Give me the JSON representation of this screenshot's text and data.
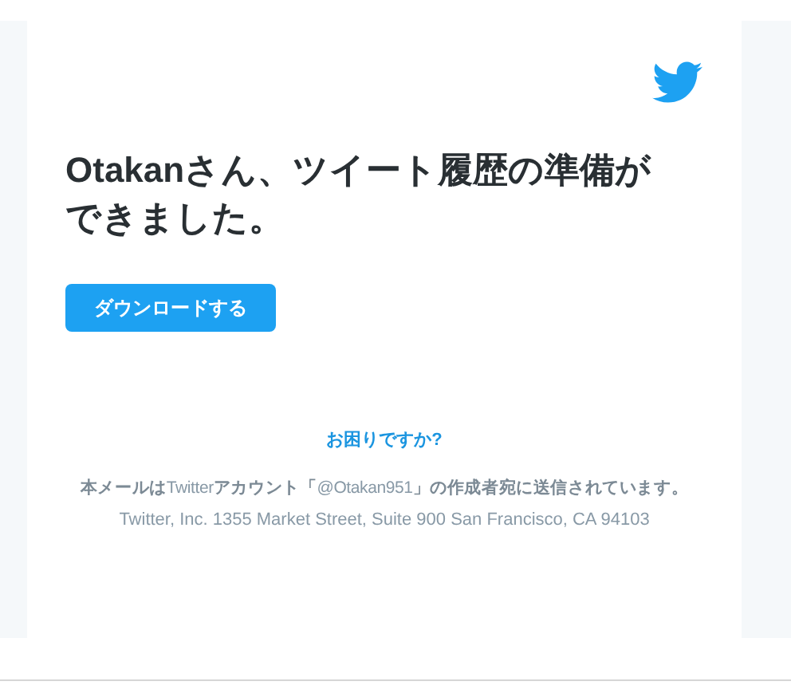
{
  "email": {
    "headline": "Otakanさん、ツイート履歴の準備ができました。",
    "download_button": "ダウンロードする",
    "help_link": "お困りですか?",
    "footer_notice": "**本メールは**Twitter**アカウント「**@Otakan951**」の作成者宛に送信されています。**",
    "footer_address": "Twitter, Inc. 1355 Market Street, Suite 900 San Francisco, CA 94103"
  }
}
